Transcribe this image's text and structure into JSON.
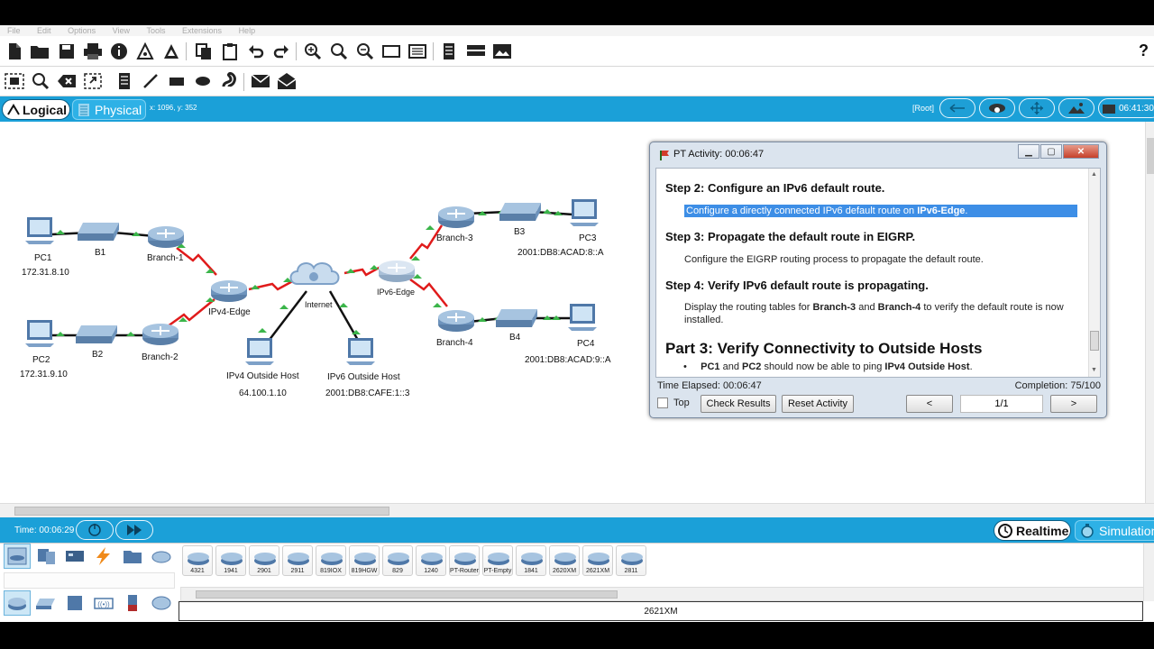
{
  "menu": [
    "File",
    "Edit",
    "Options",
    "View",
    "Tools",
    "Extensions",
    "Help"
  ],
  "toolbar": {
    "help_label": "?"
  },
  "modebar": {
    "logical_label": "Logical",
    "physical_label": "Physical",
    "coords": "x: 1096, y: 352",
    "root_label": "[Root]",
    "clock": "06:41:30"
  },
  "diagram": {
    "devices": {
      "pc1": "PC1",
      "pc1_ip": "172.31.8.10",
      "b1": "B1",
      "branch1": "Branch-1",
      "pc2": "PC2",
      "pc2_ip": "172.31.9.10",
      "b2": "B2",
      "branch2": "Branch-2",
      "ipv4edge": "IPv4-Edge",
      "internet": "Internet",
      "ipv6edge": "IPv6-Edge",
      "ipv4host": "IPv4 Outside Host",
      "ipv4host_ip": "64.100.1.10",
      "ipv6host": "IPv6 Outside Host",
      "ipv6host_ip": "2001:DB8:CAFE:1::3",
      "branch3": "Branch-3",
      "b3": "B3",
      "pc3": "PC3",
      "pc3_ip": "2001:DB8:ACAD:8::A",
      "branch4": "Branch-4",
      "b4": "B4",
      "pc4": "PC4",
      "pc4_ip": "2001:DB8:ACAD:9::A"
    },
    "colors": {
      "serial": "#e01b1b",
      "ethernet": "#111111",
      "port_up": "#3bb54a"
    }
  },
  "activity": {
    "title": "PT Activity: 00:06:47",
    "step2_heading": "Step 2:  Configure an IPv6 default route.",
    "step2_text_a": "Configure a directly connected IPv6 default route on ",
    "step2_text_b": "IPv6-Edge",
    "step2_text_c": ".",
    "step3_heading": "Step 3:  Propagate the default route in EIGRP.",
    "step3_text": "Configure the EIGRP routing process to propagate the default route.",
    "step4_heading": "Step 4:  Verify IPv6 default route is propagating.",
    "step4_text_a": "Display the routing tables for ",
    "step4_text_b": "Branch-3",
    "step4_text_c": " and ",
    "step4_text_d": "Branch-4",
    "step4_text_e": " to verify the default route is now installed.",
    "part3_heading": "Part 3:  Verify Connectivity to Outside Hosts",
    "bullet_a": "PC1",
    "bullet_b": " and ",
    "bullet_c": "PC2",
    "bullet_d": " should now be able to ping ",
    "bullet_e": "IPv4 Outside Host",
    "bullet_f": ".",
    "time_elapsed": "Time Elapsed: 00:06:47",
    "completion": "Completion: 75/100",
    "top_label": "Top",
    "check_results": "Check Results",
    "reset_activity": "Reset Activity",
    "prev_label": "<",
    "page": "1/1",
    "next_label": ">"
  },
  "timebar": {
    "time": "Time: 00:06:29",
    "realtime_label": "Realtime",
    "simulation_label": "Simulation"
  },
  "palette": {
    "models": [
      "4321",
      "1941",
      "2901",
      "2911",
      "819IOX",
      "819HGW",
      "829",
      "1240",
      "PT-Router",
      "PT-Empty",
      "1841",
      "2620XM",
      "2621XM",
      "2811"
    ],
    "selected_model": "2621XM"
  }
}
